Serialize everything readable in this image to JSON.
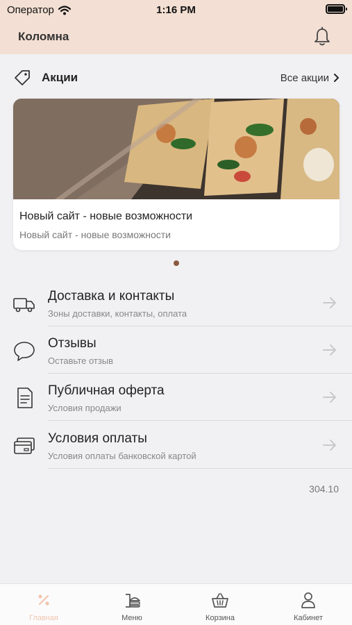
{
  "status_bar": {
    "carrier": "Оператор",
    "time": "1:16 PM"
  },
  "header": {
    "city": "Коломна"
  },
  "promotions": {
    "title": "Акции",
    "all_link": "Все акции",
    "cards": [
      {
        "title": "Новый сайт - новые возможности",
        "subtitle": "Новый сайт - новые возможности"
      }
    ]
  },
  "menu": [
    {
      "title": "Доставка и контакты",
      "subtitle": "Зоны доставки, контакты, оплата",
      "icon": "truck-icon"
    },
    {
      "title": "Отзывы",
      "subtitle": "Оставьте отзыв",
      "icon": "chat-bubble-icon"
    },
    {
      "title": "Публичная оферта",
      "subtitle": "Условия продажи",
      "icon": "document-icon"
    },
    {
      "title": "Условия оплаты",
      "subtitle": "Условия оплаты банковской картой",
      "icon": "credit-card-icon"
    }
  ],
  "version": "304.10",
  "tabbar": [
    {
      "label": "Главная",
      "icon": "discount-icon",
      "active": true
    },
    {
      "label": "Меню",
      "icon": "food-menu-icon",
      "active": false
    },
    {
      "label": "Корзина",
      "icon": "basket-icon",
      "active": false
    },
    {
      "label": "Кабинет",
      "icon": "user-icon",
      "active": false
    }
  ],
  "colors": {
    "header_bg": "#f3dfd3",
    "accent": "#f1c5ae",
    "background": "#f1f1f3"
  }
}
